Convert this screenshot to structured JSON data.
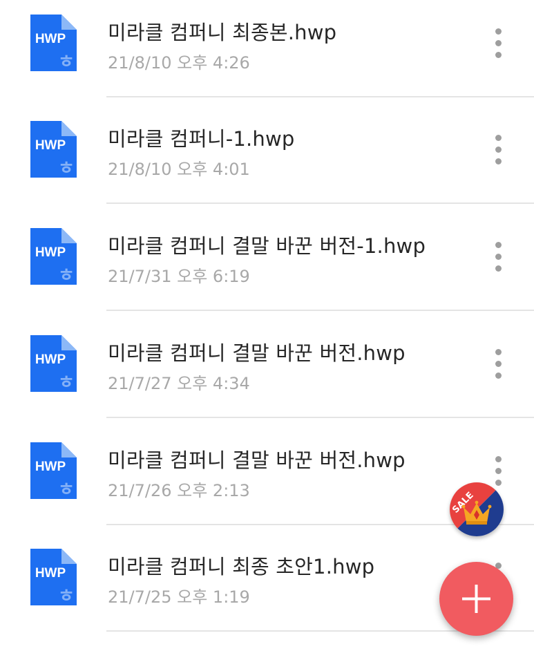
{
  "files": [
    {
      "name": "미라클 컴퍼니 최종본.hwp",
      "date": "21/8/10 오후 4:26",
      "icon": "hwp-file-icon"
    },
    {
      "name": "미라클 컴퍼니-1.hwp",
      "date": "21/8/10 오후 4:01",
      "icon": "hwp-file-icon"
    },
    {
      "name": "미라클 컴퍼니 결말 바꾼 버전-1.hwp",
      "date": "21/7/31 오후 6:19",
      "icon": "hwp-file-icon"
    },
    {
      "name": "미라클 컴퍼니 결말 바꾼 버전.hwp",
      "date": "21/7/27 오후 4:34",
      "icon": "hwp-file-icon"
    },
    {
      "name": "미라클 컴퍼니 결말 바꾼 버전.hwp",
      "date": "21/7/26 오후 2:13",
      "icon": "hwp-file-icon"
    },
    {
      "name": "미라클 컴퍼니 최종 초안1.hwp",
      "date": "21/7/25 오후 1:19",
      "icon": "hwp-file-icon"
    }
  ],
  "file_icon_label": "HWP",
  "file_icon_glyph": "ㅎ",
  "sale_badge": {
    "label": "SALE",
    "icon": "crown-icon"
  },
  "fab": {
    "icon": "plus-icon"
  },
  "colors": {
    "file_icon": "#1e6ff1",
    "file_icon_fold": "#8cb8f7",
    "fab": "#f15b60",
    "sale_badge_red": "#e8413f",
    "sale_badge_navy": "#1f3c8f",
    "crown_gold": "#f5a623",
    "crown_red": "#d8312b"
  }
}
